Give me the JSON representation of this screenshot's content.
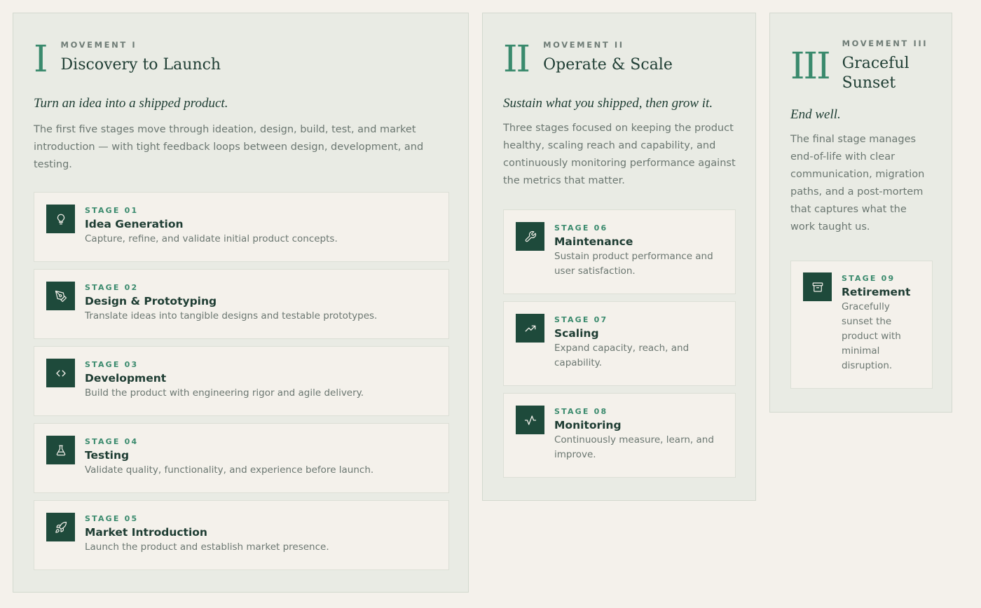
{
  "colors": {
    "accent": "#3a8a6d",
    "icon_bg": "#1e4a3b",
    "heading": "#1e3d33",
    "page_bg": "#f4f1eb",
    "panel_bg": "#e9ebe4"
  },
  "movements": [
    {
      "numeral": "I",
      "kicker": "MOVEMENT I",
      "title": "Discovery to Launch",
      "tagline": "Turn an idea into a shipped product.",
      "description": "The first five stages move through ideation, design, build, test, and market introduction — with tight feedback loops between design, development, and testing.",
      "stages": [
        {
          "number": "STAGE 01",
          "name": "Idea Generation",
          "description": "Capture, refine, and validate initial product concepts.",
          "icon": "lightbulb-icon"
        },
        {
          "number": "STAGE 02",
          "name": "Design & Prototyping",
          "description": "Translate ideas into tangible designs and testable prototypes.",
          "icon": "pen-tool-icon"
        },
        {
          "number": "STAGE 03",
          "name": "Development",
          "description": "Build the product with engineering rigor and agile delivery.",
          "icon": "code-icon"
        },
        {
          "number": "STAGE 04",
          "name": "Testing",
          "description": "Validate quality, functionality, and experience before launch.",
          "icon": "flask-icon"
        },
        {
          "number": "STAGE 05",
          "name": "Market Introduction",
          "description": "Launch the product and establish market presence.",
          "icon": "rocket-icon"
        }
      ]
    },
    {
      "numeral": "II",
      "kicker": "MOVEMENT II",
      "title": "Operate & Scale",
      "tagline": "Sustain what you shipped, then grow it.",
      "description": "Three stages focused on keeping the product healthy, scaling reach and capability, and continuously monitoring performance against the metrics that matter.",
      "stages": [
        {
          "number": "STAGE 06",
          "name": "Maintenance",
          "description": "Sustain product performance and user satisfaction.",
          "icon": "wrench-icon"
        },
        {
          "number": "STAGE 07",
          "name": "Scaling",
          "description": "Expand capacity, reach, and capability.",
          "icon": "trending-up-icon"
        },
        {
          "number": "STAGE 08",
          "name": "Monitoring",
          "description": "Continuously measure, learn, and improve.",
          "icon": "activity-icon"
        }
      ]
    },
    {
      "numeral": "III",
      "kicker": "MOVEMENT III",
      "title": "Graceful Sunset",
      "tagline": "End well.",
      "description": "The final stage manages end-of-life with clear communication, migration paths, and a post-mortem that captures what the work taught us.",
      "stages": [
        {
          "number": "STAGE 09",
          "name": "Retirement",
          "description": "Gracefully sunset the product with minimal disruption.",
          "icon": "archive-icon"
        }
      ]
    }
  ]
}
